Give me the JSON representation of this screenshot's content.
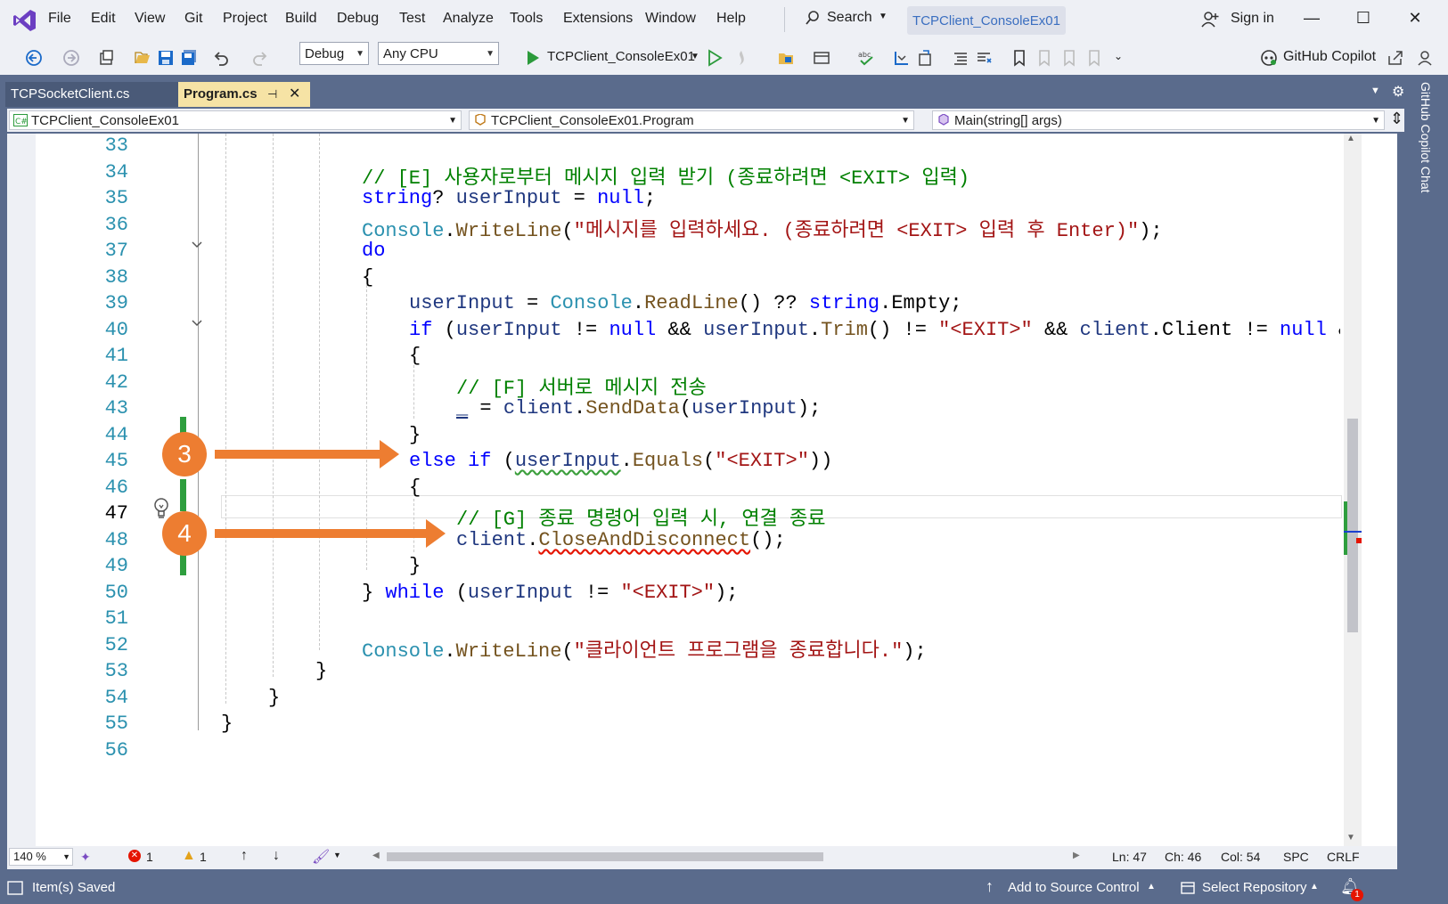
{
  "menu": [
    "File",
    "Edit",
    "View",
    "Git",
    "Project",
    "Build",
    "Debug",
    "Test",
    "Analyze",
    "Tools",
    "Extensions",
    "Window",
    "Help"
  ],
  "search_label": "Search",
  "solution_title": "TCPClient_ConsoleEx01",
  "sign_in": "Sign in",
  "toolbar": {
    "config": "Debug",
    "platform": "Any CPU",
    "run_target": "TCPClient_ConsoleEx01",
    "copilot": "GitHub Copilot"
  },
  "tabs": [
    {
      "label": "TCPSocketClient.cs",
      "active": false
    },
    {
      "label": "Program.cs",
      "active": true
    }
  ],
  "nav": {
    "project": "TCPClient_ConsoleEx01",
    "type": "TCPClient_ConsoleEx01.Program",
    "member": "Main(string[] args)"
  },
  "copilot_chat_label": "GitHub Copilot Chat",
  "line_numbers": [
    "33",
    "34",
    "35",
    "36",
    "37",
    "38",
    "39",
    "40",
    "41",
    "42",
    "43",
    "44",
    "45",
    "46",
    "47",
    "48",
    "49",
    "50",
    "51",
    "52",
    "53",
    "54",
    "55",
    "56"
  ],
  "current_line": "47",
  "code": {
    "l34": "// [E] 사용자로부터 메시지 입력 받기 (종료하려면 <EXIT> 입력)",
    "l36_str": "\"메시지를 입력하세요. (종료하려면 <EXIT> 입력 후 Enter)\"",
    "l42": "// [F] 서버로 메시지 전송",
    "l47": "// [G] 종료 명령어 입력 시, 연결 종료",
    "l52_str": "\"클라이언트 프로그램을 종료합니다.\""
  },
  "annotations": [
    {
      "label": "3",
      "target_line": "45"
    },
    {
      "label": "4",
      "target_line": "48"
    }
  ],
  "editor_status": {
    "zoom": "140 %",
    "errors": "1",
    "warnings": "1",
    "ln": "Ln: 47",
    "ch": "Ch: 46",
    "col": "Col: 54",
    "spc": "SPC",
    "crlf": "CRLF"
  },
  "status_bar": {
    "message": "Item(s) Saved",
    "source_control": "Add to Source Control",
    "repository": "Select Repository",
    "notifications": "1"
  },
  "colors": {
    "accent_orange": "#ed7d31",
    "frame": "#5a6b8c",
    "keyword": "#0000ff",
    "comment": "#008000",
    "string": "#a31515",
    "type": "#2b91af"
  }
}
